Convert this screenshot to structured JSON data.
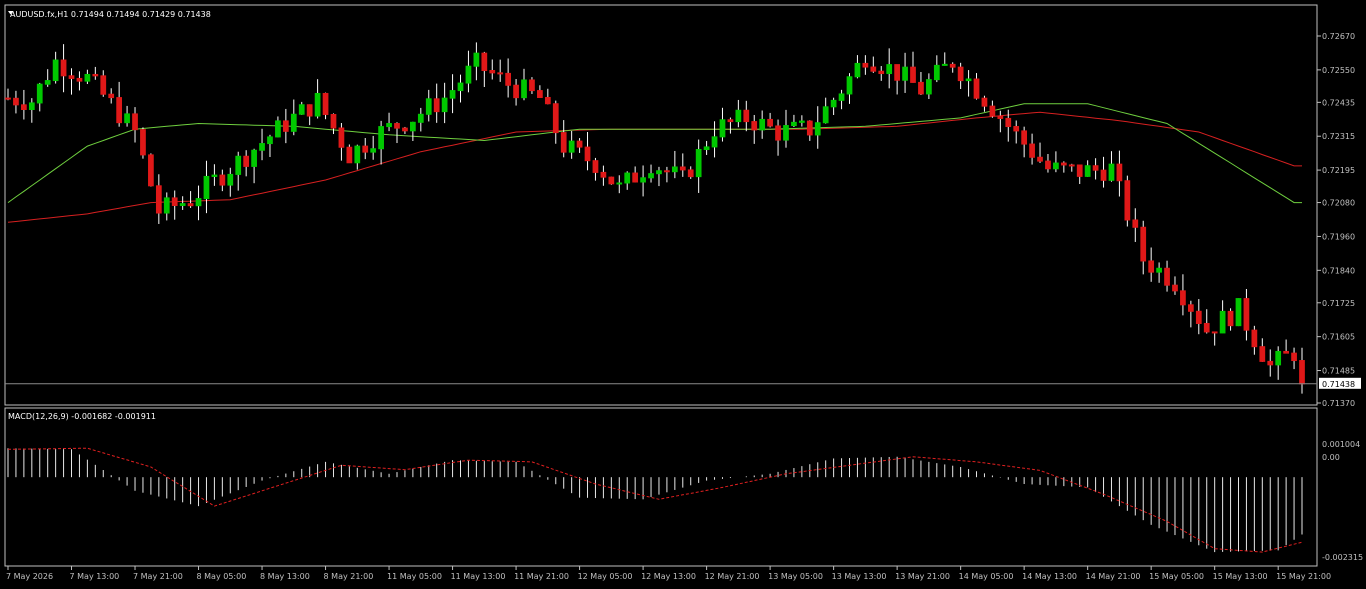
{
  "header": {
    "symbol_line": "AUDUSD.fx,H1  0.71494 0.71494 0.71429 0.71438",
    "current_price": "0.71438"
  },
  "macd": {
    "label": "MACD(12,26,9) -0.001682 -0.001911",
    "ticks": [
      "0.001004",
      "0.00",
      "-0.002315"
    ],
    "tick_values": [
      0.001004,
      0.0,
      -0.002315
    ]
  },
  "colors": {
    "background": "#000000",
    "axis": "#c0c0c0",
    "bull": "#00c800",
    "bear": "#e01818",
    "ma_fast": "#6fcf3f",
    "ma_slow": "#d62020",
    "signal": "#e02020",
    "histogram": "#e8e8e8",
    "price_tag_bg": "#ffffff"
  },
  "chart_data": [
    {
      "type": "candlestick",
      "symbol": "AUDUSD.fx",
      "timeframe": "H1",
      "grid": false,
      "ylim": [
        0.7137,
        0.7267
      ],
      "y_ticks": [
        0.7267,
        0.7255,
        0.72435,
        0.72315,
        0.72195,
        0.7208,
        0.7196,
        0.7184,
        0.71725,
        0.71605,
        0.71485,
        0.7137
      ],
      "y_tick_labels": [
        "0.72670",
        "0.72550",
        "0.72435",
        "0.72315",
        "0.72195",
        "0.72080",
        "0.71960",
        "0.71840",
        "0.71725",
        "0.71605",
        "0.71485",
        "0.71370"
      ],
      "x_tick_labels": [
        "7 May 2026",
        "7 May 13:00",
        "7 May 21:00",
        "8 May 05:00",
        "8 May 13:00",
        "8 May 21:00",
        "11 May 05:00",
        "11 May 13:00",
        "11 May 21:00",
        "12 May 05:00",
        "12 May 13:00",
        "12 May 21:00",
        "13 May 05:00",
        "13 May 13:00",
        "13 May 21:00",
        "14 May 05:00",
        "14 May 13:00",
        "14 May 21:00",
        "15 May 05:00",
        "15 May 13:00",
        "15 May 21:00"
      ],
      "x_tick_index": [
        0,
        8,
        16,
        24,
        32,
        40,
        48,
        56,
        64,
        72,
        80,
        88,
        96,
        104,
        112,
        120,
        128,
        136,
        144,
        152,
        160
      ],
      "bar_count": 164,
      "anchors": [
        [
          0,
          0.7245
        ],
        [
          3,
          0.7244
        ],
        [
          6,
          0.7258
        ],
        [
          10,
          0.7252
        ],
        [
          13,
          0.7243
        ],
        [
          16,
          0.7233
        ],
        [
          19,
          0.7205
        ],
        [
          23,
          0.7209
        ],
        [
          27,
          0.7218
        ],
        [
          31,
          0.7227
        ],
        [
          35,
          0.7236
        ],
        [
          39,
          0.7244
        ],
        [
          43,
          0.7225
        ],
        [
          47,
          0.7233
        ],
        [
          51,
          0.7238
        ],
        [
          55,
          0.7245
        ],
        [
          59,
          0.7257
        ],
        [
          63,
          0.725
        ],
        [
          67,
          0.7245
        ],
        [
          70,
          0.7228
        ],
        [
          74,
          0.7222
        ],
        [
          77,
          0.7213
        ],
        [
          81,
          0.7222
        ],
        [
          85,
          0.7216
        ],
        [
          89,
          0.7234
        ],
        [
          93,
          0.7238
        ],
        [
          97,
          0.7233
        ],
        [
          101,
          0.7234
        ],
        [
          105,
          0.7248
        ],
        [
          108,
          0.726
        ],
        [
          112,
          0.7254
        ],
        [
          115,
          0.7248
        ],
        [
          119,
          0.7258
        ],
        [
          123,
          0.7245
        ],
        [
          127,
          0.7232
        ],
        [
          131,
          0.722
        ],
        [
          135,
          0.7219
        ],
        [
          139,
          0.722
        ],
        [
          143,
          0.7188
        ],
        [
          147,
          0.718
        ],
        [
          151,
          0.7163
        ],
        [
          155,
          0.717
        ],
        [
          159,
          0.715
        ],
        [
          162,
          0.7155
        ],
        [
          163,
          0.71438
        ]
      ],
      "ma_fast": [
        [
          0,
          0.7208
        ],
        [
          10,
          0.7228
        ],
        [
          16,
          0.7234
        ],
        [
          24,
          0.7236
        ],
        [
          36,
          0.7235
        ],
        [
          48,
          0.7232
        ],
        [
          60,
          0.723
        ],
        [
          72,
          0.7234
        ],
        [
          84,
          0.7234
        ],
        [
          96,
          0.7234
        ],
        [
          108,
          0.7235
        ],
        [
          120,
          0.7238
        ],
        [
          128,
          0.7243
        ],
        [
          136,
          0.7243
        ],
        [
          146,
          0.7236
        ],
        [
          154,
          0.7222
        ],
        [
          162,
          0.7208
        ]
      ],
      "ma_slow": [
        [
          0,
          0.7201
        ],
        [
          10,
          0.7204
        ],
        [
          18,
          0.7208
        ],
        [
          28,
          0.7209
        ],
        [
          40,
          0.7216
        ],
        [
          52,
          0.7226
        ],
        [
          64,
          0.7233
        ],
        [
          76,
          0.7234
        ],
        [
          88,
          0.7234
        ],
        [
          100,
          0.7234
        ],
        [
          112,
          0.7235
        ],
        [
          122,
          0.7238
        ],
        [
          130,
          0.724
        ],
        [
          140,
          0.7237
        ],
        [
          150,
          0.7233
        ],
        [
          156,
          0.7227
        ],
        [
          162,
          0.7221
        ]
      ],
      "current_price": 0.71438
    },
    {
      "type": "histogram",
      "title": "MACD(12,26,9)",
      "main": -0.001682,
      "signal": -0.001911,
      "ylim": [
        -0.002315,
        0.001004
      ],
      "hist_anchors": [
        [
          0,
          0.00085
        ],
        [
          8,
          0.00082
        ],
        [
          16,
          -0.0004
        ],
        [
          24,
          -0.00085
        ],
        [
          32,
          -0.0001
        ],
        [
          40,
          0.00045
        ],
        [
          48,
          0.0001
        ],
        [
          56,
          0.0005
        ],
        [
          64,
          0.00045
        ],
        [
          72,
          -0.0006
        ],
        [
          80,
          -0.00065
        ],
        [
          88,
          -0.0001
        ],
        [
          96,
          0.0001
        ],
        [
          104,
          0.00055
        ],
        [
          112,
          0.0006
        ],
        [
          120,
          0.0003
        ],
        [
          128,
          -0.0002
        ],
        [
          136,
          -0.0003
        ],
        [
          144,
          -0.0014
        ],
        [
          152,
          -0.0022
        ],
        [
          160,
          -0.00215
        ],
        [
          163,
          -0.001682
        ]
      ],
      "signal_anchors": [
        [
          0,
          0.00082
        ],
        [
          10,
          0.00085
        ],
        [
          18,
          0.0003
        ],
        [
          26,
          -0.00085
        ],
        [
          34,
          -0.00025
        ],
        [
          42,
          0.00035
        ],
        [
          50,
          0.00022
        ],
        [
          58,
          0.0005
        ],
        [
          66,
          0.00045
        ],
        [
          74,
          -0.0002
        ],
        [
          82,
          -0.00065
        ],
        [
          90,
          -0.0003
        ],
        [
          98,
          0.0001
        ],
        [
          106,
          0.00035
        ],
        [
          114,
          0.0006
        ],
        [
          122,
          0.00045
        ],
        [
          130,
          0.0002
        ],
        [
          138,
          -0.0005
        ],
        [
          146,
          -0.0013
        ],
        [
          152,
          -0.0021
        ],
        [
          158,
          -0.0022
        ],
        [
          163,
          -0.001911
        ]
      ]
    }
  ]
}
